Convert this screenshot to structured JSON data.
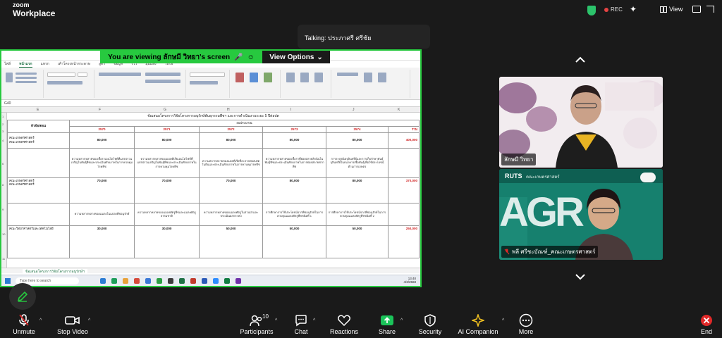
{
  "app": {
    "logo_line1": "zoom",
    "logo_line2": "Workplace",
    "rec_label": "REC",
    "view_label": "View"
  },
  "talking": {
    "text": "Talking: ประภาศรี ศรีชัย"
  },
  "share": {
    "banner_text": "You are viewing  ลักษมี วิทยา's screen",
    "view_options_label": "View Options",
    "excel": {
      "menu": [
        "ไฟล์",
        "หน้าแรก",
        "แทรก",
        "เค้าโครงหน้ากระดาษ",
        "สูตร",
        "ข้อมูล",
        "รีวิว",
        "มุมมอง",
        "วิธีใช้"
      ],
      "active_menu_index": 1,
      "name_box": "G40",
      "columns": [
        "E",
        "F",
        "G",
        "H",
        "I",
        "J",
        "K"
      ],
      "sheet_title": "ข้อเสนอโครงการวิจัยโครงการอนุรักษ์พันธุกรรมพืชฯ และการดำเนินงานระยะ 5 ปีต่อปต",
      "header_group": "งบประมาณ",
      "header_left": "หัวข้อ/ตอน",
      "years": [
        "2570",
        "2571",
        "2572",
        "2573",
        "2574",
        "รวม"
      ],
      "rows": [
        {
          "label": "คณะเกษตรศาสตร์",
          "label2": "คณะเกษตรศาสตร์",
          "values": [
            "80,000",
            "80,000",
            "80,000",
            "80,000",
            "80,000"
          ],
          "total": "400,000",
          "descs": [
            "ความหลากหลายของเชื้อราเอนโดไฟท์ที่แปรปรวนเจริญในพันธุ์พืชและประเมินศักยภาพในการควบคุมโรคพืช",
            "ความหลากหลายของแบคทีเรียเอนโดไฟท์ที่แปรปรวนเจริญในพันธุ์พืชและประเมินศักยภาพในการควบคุมโรคพืช",
            "ความหลากหลายของแบคทีเรียที่ละลายฟอสเฟตในดินและประเมินศักยภาพในการควบคุมโรคพืช",
            "ความหลากหลายของเชื้อราที่ย่อยสลายลิกนินในพันธุ์พืชและประเมินศักยภาพในการย่อยสลายซากพืช",
            "การระบุชนิดจุลินทรีย์และการเก็บรักษาพันธุ์จุลินทรีย์ในธนาคารเชื้อพันธุ์เพื่อใช้ประโยชน์ด้านการเกษตร"
          ]
        },
        {
          "label": "คณะเกษตรศาสตร์",
          "label2": "คณะเกษตรศาสตร์",
          "values": [
            "70,000",
            "70,000",
            "70,000",
            "80,000",
            "80,000"
          ],
          "total": "370,000",
          "descs": [
            "ความหลากหลายของแมลงในแปลงพืชอนุรักษ์",
            "ความหลากหลายของแมลงศัตรูพืชและแมลงศัตรูธรรมชาติ",
            "ความหลากหลายของแมลงศัตรูในสวนป่าและประเมินผลกระทบ",
            "การศึกษาการใช้ประโยชน์จากพืชอนุรักษ์ในการควบคุมแมลงศัตรูพืชชนิดที่ 1",
            "การศึกษาการใช้ประโยชน์จากพืชอนุรักษ์ในการควบคุมแมลงศัตรูพืชชนิดที่ 2"
          ]
        },
        {
          "label": "คณะวิทยาศาสตร์และเทคโนโลยี",
          "values": [
            "30,000",
            "30,000",
            "50,000",
            "50,000",
            "50,000"
          ],
          "total": "250,000"
        }
      ],
      "sheet_tab": "ข้อเสนอโครงการวิจัยโครงการอนุรักษ์ฯ",
      "taskbar_search": "Type here to search",
      "clock_time": "13:40",
      "clock_date": "4/3/2568"
    }
  },
  "participants": [
    {
      "name": "ลักษมี วิทยา",
      "muted": false
    },
    {
      "name": "พลี ศรีชะบัณฑ์_คณะเกษตรศาสตร์",
      "muted": true,
      "banner_top": "RUTS",
      "banner_sub": "คณะเกษตรศาสตร์",
      "big_text": "AGR"
    }
  ],
  "toolbar": {
    "unmute": "Unmute",
    "stop_video": "Stop Video",
    "participants": "Participants",
    "participants_count": "10",
    "chat": "Chat",
    "reactions": "Reactions",
    "share": "Share",
    "security": "Security",
    "ai_companion": "AI Companion",
    "more": "More",
    "end": "End"
  },
  "colors": {
    "share_border": "#27c93f",
    "end_red": "#e02828",
    "share_green": "#1bc45a"
  },
  "icons": [
    "shield-icon",
    "sparkle-icon",
    "grid-view-icon",
    "pip-icon",
    "fullscreen-icon",
    "pencil-icon",
    "mic-muted-icon",
    "video-icon",
    "participants-icon",
    "chat-icon",
    "heart-icon",
    "share-arrow-icon",
    "security-shield-icon",
    "ai-sparkle-icon",
    "more-icon",
    "end-icon",
    "chevron-up-icon",
    "chevron-down-icon"
  ]
}
